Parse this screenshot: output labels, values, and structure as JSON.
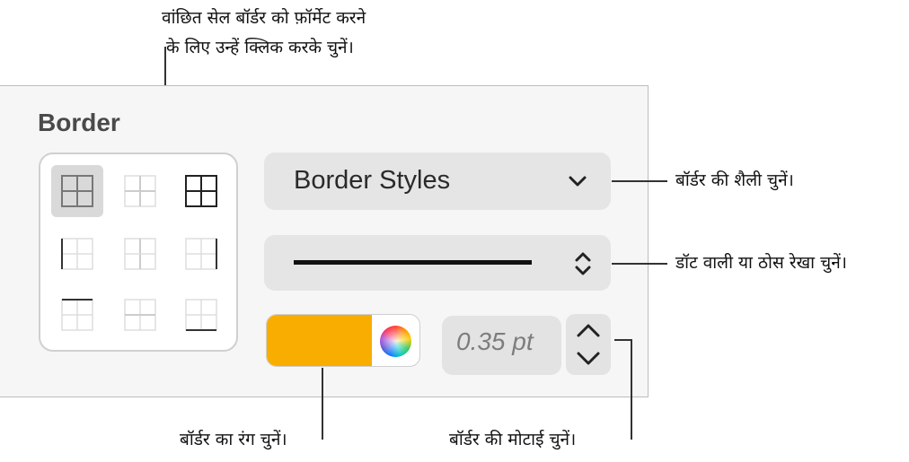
{
  "callouts": {
    "cells_line1": "वांछित सेल बॉर्डर को फ़ॉर्मेट करने",
    "cells_line2": "के लिए उन्हें क्लिक करके चुनें।",
    "style": "बॉर्डर की शैली चुनें।",
    "line_type": "डॉट वाली या ठोस रेखा चुनें।",
    "color": "बॉर्डर का रंग चुनें।",
    "thickness": "बॉर्डर की मोटाई चुनें।"
  },
  "panel": {
    "title": "Border",
    "border_style_label": "Border Styles",
    "border_color": "#f8ad00",
    "thickness_value": "0.35 pt"
  },
  "icons": {
    "style_dropdown": "chevron-down-icon",
    "line_type_popup": "up-down-chevron-icon",
    "color_picker": "color-wheel-icon",
    "stepper_up": "chevron-up-icon",
    "stepper_down": "chevron-down-icon"
  }
}
